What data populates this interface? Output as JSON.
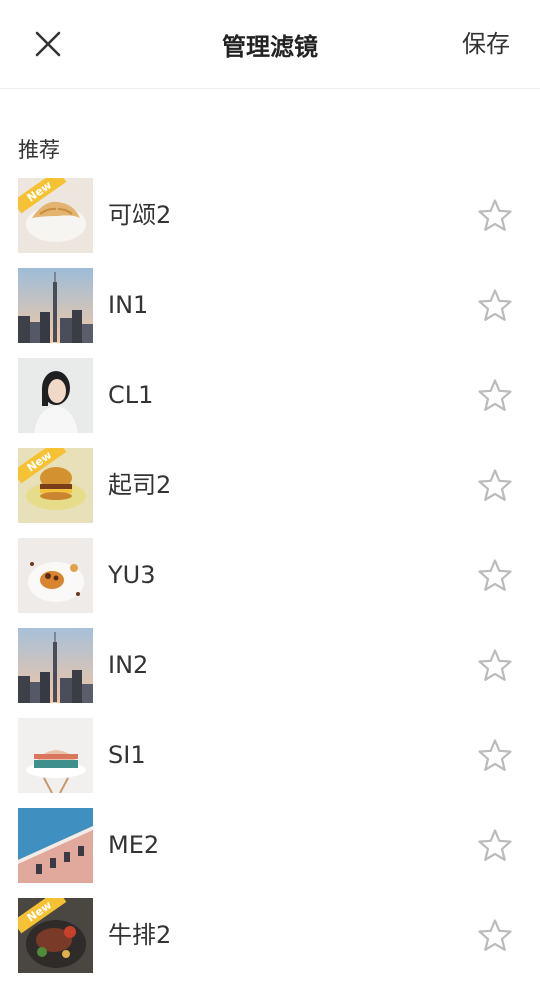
{
  "header": {
    "title": "管理滤镜",
    "save_label": "保存"
  },
  "section": {
    "label": "推荐"
  },
  "filters": [
    {
      "name": "可颂2",
      "new": true,
      "thumb": "croissant"
    },
    {
      "name": "IN1",
      "new": false,
      "thumb": "city"
    },
    {
      "name": "CL1",
      "new": false,
      "thumb": "portrait"
    },
    {
      "name": "起司2",
      "new": true,
      "thumb": "burger"
    },
    {
      "name": "YU3",
      "new": false,
      "thumb": "dessert"
    },
    {
      "name": "IN2",
      "new": false,
      "thumb": "city"
    },
    {
      "name": "SI1",
      "new": false,
      "thumb": "cake"
    },
    {
      "name": "ME2",
      "new": false,
      "thumb": "building"
    },
    {
      "name": "牛排2",
      "new": true,
      "thumb": "steak"
    }
  ],
  "badge_text": "New",
  "colors": {
    "badge": "#f6c233",
    "star_outline": "#bbbbbb",
    "text": "#333333"
  }
}
